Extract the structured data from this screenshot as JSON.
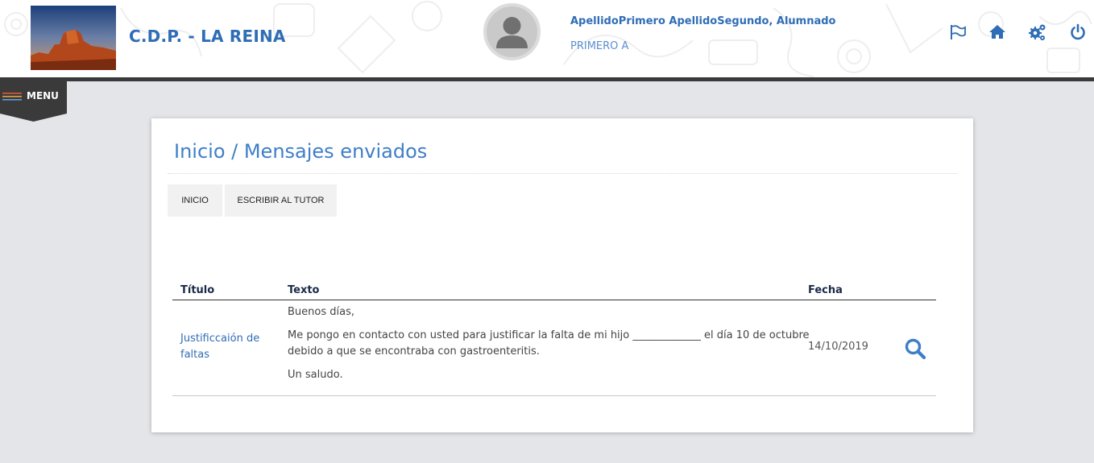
{
  "header": {
    "school_name": "C.D.P. - LA REINA",
    "user_name": "ApellidoPrimero ApellidoSegundo, Alumnado",
    "user_group": "PRIMERO A",
    "icons": [
      "flag-icon",
      "home-icon",
      "settings-icon",
      "power-icon"
    ]
  },
  "menu": {
    "label": "MENU"
  },
  "page": {
    "breadcrumb": "Inicio / Mensajes enviados",
    "buttons": {
      "inicio": "INICIO",
      "escribir": "ESCRIBIR AL TUTOR"
    }
  },
  "table": {
    "headers": {
      "titulo": "Título",
      "texto": "Texto",
      "fecha": "Fecha"
    },
    "rows": [
      {
        "titulo": "Justificcaión de faltas",
        "texto": [
          "Buenos días,",
          "Me pongo en contacto con usted para justificar la falta de mi hijo _____________ el día  10 de octubre",
          "debido a que se encontraba con gastroenteritis.",
          "Un saludo."
        ],
        "fecha": "14/10/2019",
        "action_icon": "search-icon"
      }
    ]
  },
  "colors": {
    "accent": "#2f6db5",
    "link": "#3f7ec7",
    "menu_bg": "#3a3a3a",
    "background": "#e4e5e9"
  }
}
